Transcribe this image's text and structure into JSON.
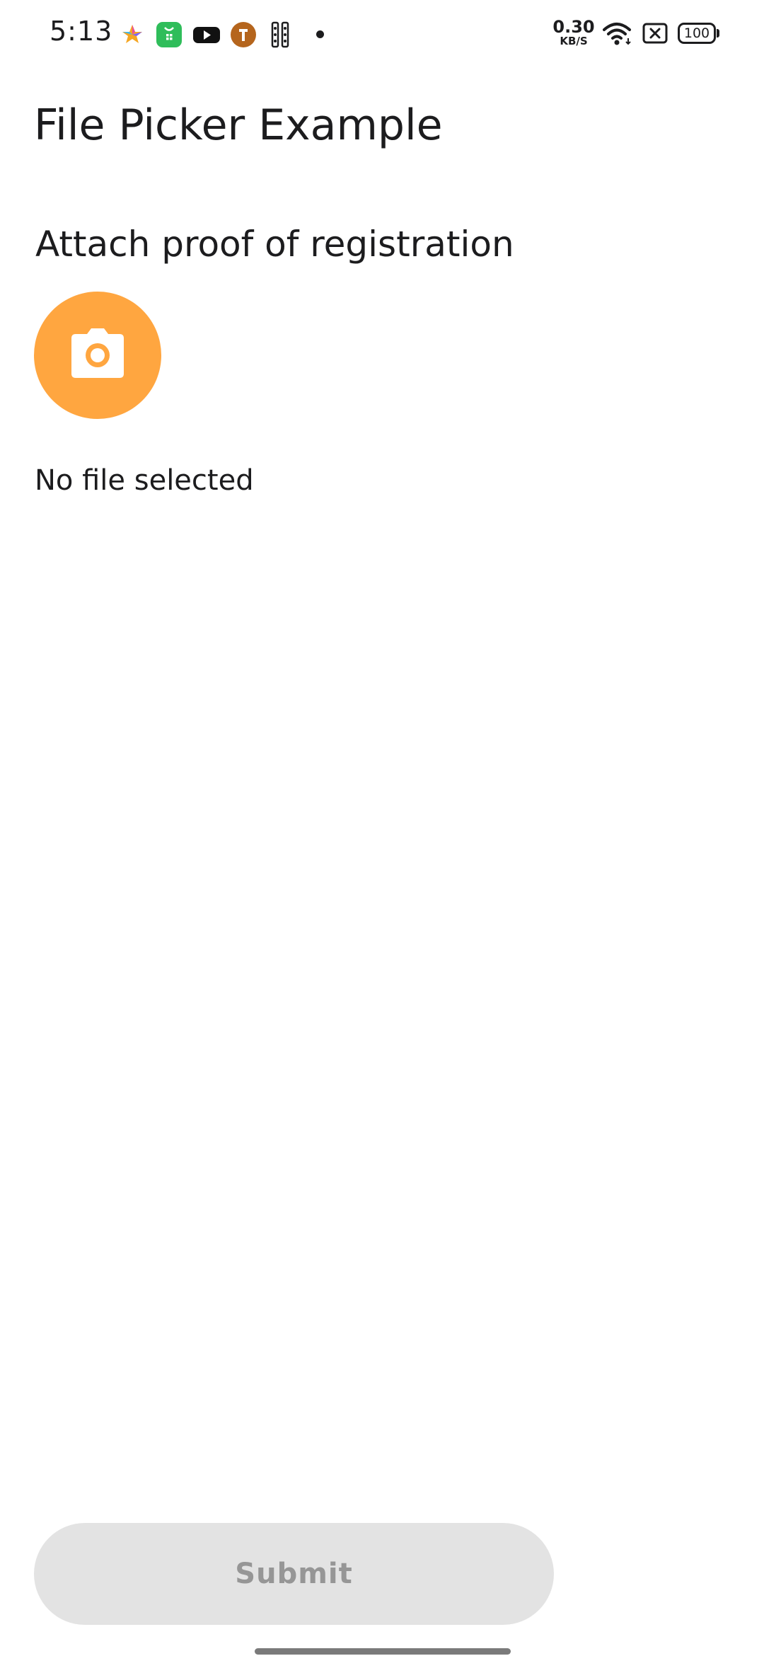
{
  "status_bar": {
    "time": "5:13",
    "network_speed_value": "0.30",
    "network_speed_unit": "KB/S",
    "battery_level": "100",
    "notification_icons": [
      "star-app-icon",
      "shopping-bag-app-icon",
      "youtube-icon",
      "orange-app-icon",
      "keypad-app-icon"
    ]
  },
  "page": {
    "title": "File Picker Example",
    "attach_label": "Attach proof of registration",
    "camera_icon": "camera-icon",
    "file_status": "No file selected",
    "submit_label": "Submit"
  },
  "colors": {
    "accent": "#ffa640",
    "submit_disabled_bg": "#e3e3e3",
    "submit_disabled_text": "#969696",
    "text": "#1c1c1e"
  }
}
